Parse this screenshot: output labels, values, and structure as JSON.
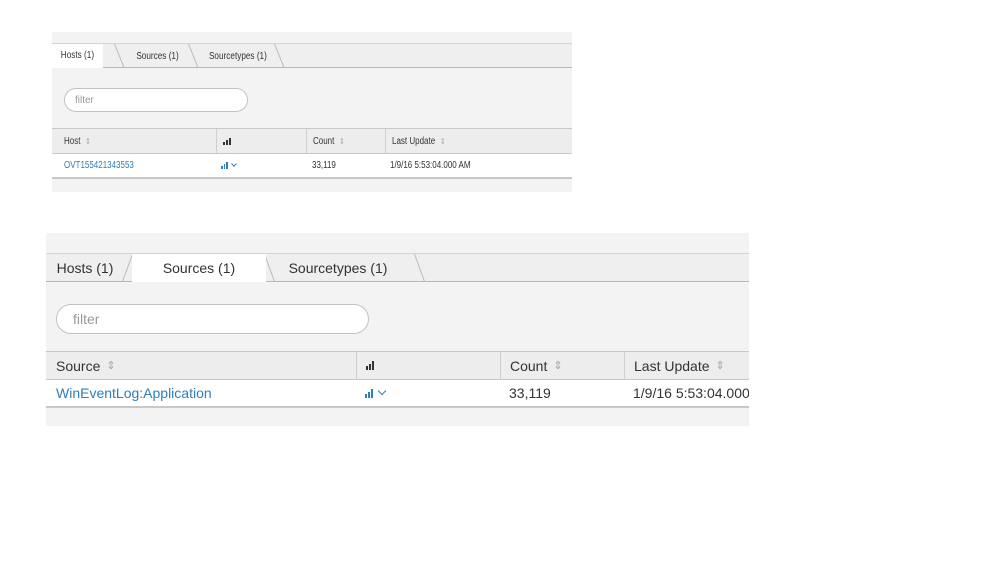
{
  "panels": [
    {
      "tabs": [
        {
          "label": "Hosts (1)",
          "active": true
        },
        {
          "label": "Sources (1)",
          "active": false
        },
        {
          "label": "Sourcetypes (1)",
          "active": false
        }
      ],
      "filter_placeholder": "filter",
      "columns": {
        "first": "Host",
        "count": "Count",
        "last_update": "Last Update"
      },
      "rows": [
        {
          "name": "OVT155421343553",
          "count": "33,119",
          "last_update": "1/9/16 5:53:04.000 AM"
        }
      ]
    },
    {
      "tabs": [
        {
          "label": "Hosts (1)",
          "active": false
        },
        {
          "label": "Sources (1)",
          "active": true
        },
        {
          "label": "Sourcetypes (1)",
          "active": false
        }
      ],
      "filter_placeholder": "filter",
      "columns": {
        "first": "Source",
        "count": "Count",
        "last_update": "Last Update"
      },
      "rows": [
        {
          "name": "WinEventLog:Application",
          "count": "33,119",
          "last_update": "1/9/16 5:53:04.000"
        }
      ]
    }
  ],
  "icons": {
    "sort": "sort-arrows-icon",
    "sparkline": "bar-chart-icon",
    "dropdown": "chevron-down-icon"
  },
  "colors": {
    "link": "#2f7dbd",
    "panel_bg": "#f3f3f3",
    "header_bg": "#ededed",
    "border": "#c8c8c8"
  }
}
